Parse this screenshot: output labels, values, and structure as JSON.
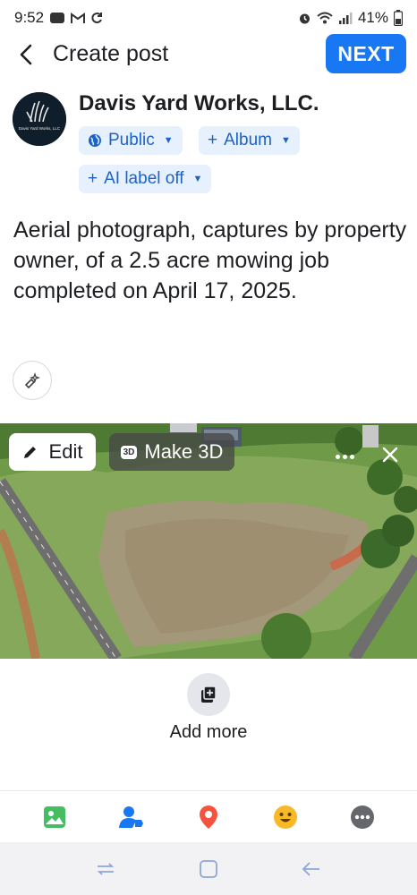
{
  "status_bar": {
    "time": "9:52",
    "battery": "41%"
  },
  "header": {
    "title": "Create post",
    "next_label": "NEXT"
  },
  "author": {
    "name": "Davis Yard Works, LLC.",
    "avatar_text": "Davis Yard Works, LLC",
    "audience_label": "Public",
    "album_label": "Album",
    "ai_label": "AI label off"
  },
  "post": {
    "text": "Aerial photograph, captures by property owner, of a 2.5 acre mowing job completed on April 17, 2025."
  },
  "media": {
    "edit_label": "Edit",
    "make3d_label": "Make 3D",
    "badge_3d": "3D"
  },
  "add_more": {
    "label": "Add more"
  },
  "toolbar": {
    "items": [
      {
        "name": "photo",
        "color": "#45bd62"
      },
      {
        "name": "tag-people",
        "color": "#1877f2"
      },
      {
        "name": "location",
        "color": "#f5533d"
      },
      {
        "name": "feeling",
        "color": "#f7b928"
      },
      {
        "name": "more",
        "color": "#65676b"
      }
    ]
  },
  "colors": {
    "accent": "#1877f2",
    "chip_bg": "#e7f0fd",
    "chip_text": "#1b63c9"
  }
}
